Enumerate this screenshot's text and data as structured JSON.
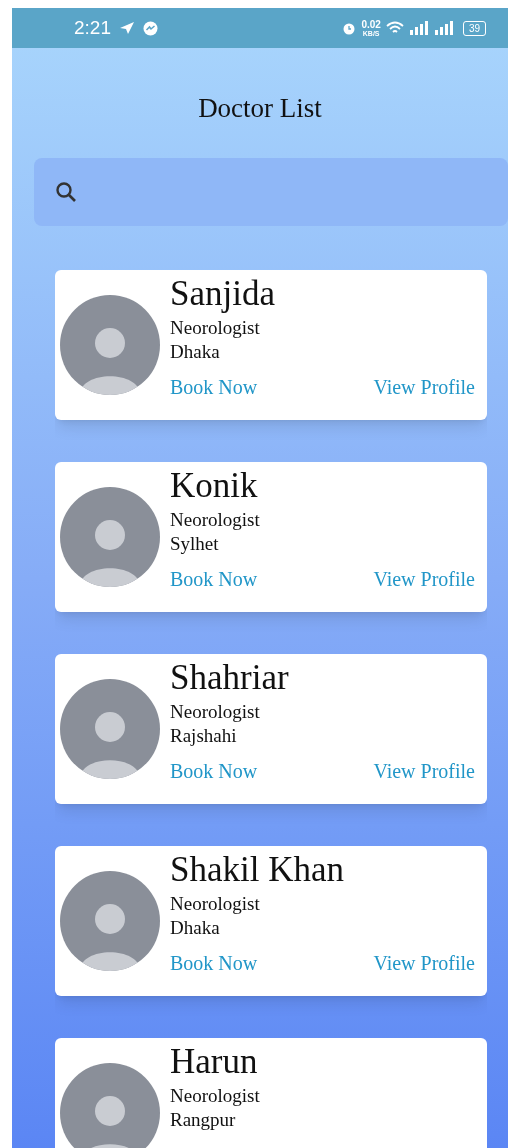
{
  "status_bar": {
    "time": "2:21",
    "data_speed": "0.02",
    "data_unit": "KB/S",
    "battery": "39"
  },
  "title": "Doctor List",
  "doctors": [
    {
      "name": "Sanjida",
      "specialty": "Neorologist",
      "city": "Dhaka",
      "actions": [
        "Book Now",
        "View Profile"
      ]
    },
    {
      "name": "Konik",
      "specialty": "Neorologist",
      "city": "Sylhet",
      "actions": [
        "Book Now",
        "View Profile"
      ]
    },
    {
      "name": "Shahriar",
      "specialty": "Neorologist",
      "city": "Rajshahi",
      "actions": [
        "Book Now",
        "View Profile"
      ]
    },
    {
      "name": "Shakil Khan",
      "specialty": "Neorologist",
      "city": "Dhaka",
      "actions": [
        "Book Now",
        "View Profile"
      ]
    },
    {
      "name": "Harun",
      "specialty": "Neorologist",
      "city": "Rangpur"
    }
  ]
}
